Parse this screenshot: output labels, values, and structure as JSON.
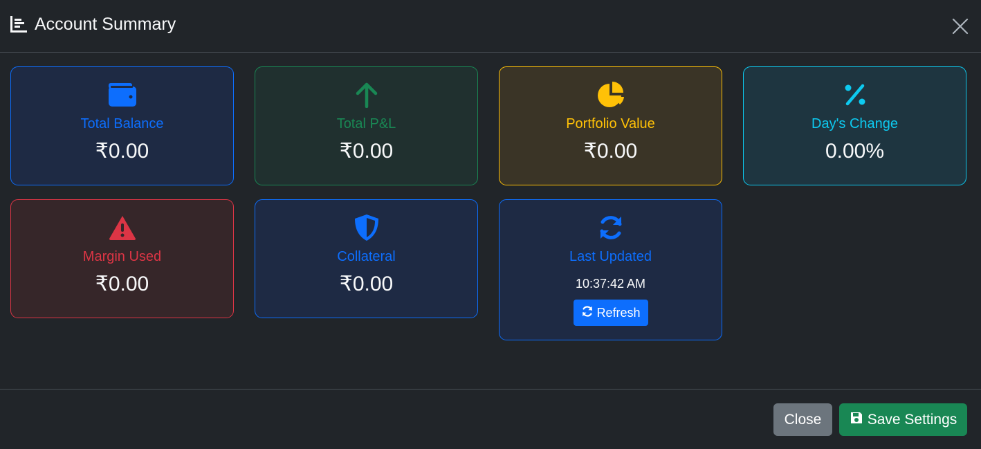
{
  "header": {
    "title": "Account Summary",
    "title_icon": "chart-bar-icon",
    "close_icon": "close-icon"
  },
  "cards": [
    {
      "label": "Total Balance",
      "value": "₹0.00",
      "icon": "wallet-icon",
      "color": "#0d6efd"
    },
    {
      "label": "Total P&L",
      "value": "₹0.00",
      "icon": "arrow-up-icon",
      "color": "#198754"
    },
    {
      "label": "Portfolio Value",
      "value": "₹0.00",
      "icon": "pie-chart-icon",
      "color": "#ffc107"
    },
    {
      "label": "Day's Change",
      "value": "0.00%",
      "icon": "percent-icon",
      "color": "#0dcaf0"
    },
    {
      "label": "Margin Used",
      "value": "₹0.00",
      "icon": "warning-icon",
      "color": "#dc3545"
    },
    {
      "label": "Collateral",
      "value": "₹0.00",
      "icon": "shield-icon",
      "color": "#0d6efd"
    },
    {
      "label": "Last Updated",
      "value": "10:37:42 AM",
      "icon": "sync-icon",
      "color": "#0d6efd",
      "action_label": "Refresh"
    }
  ],
  "footer": {
    "close_label": "Close",
    "save_label": "Save Settings",
    "save_icon": "save-icon"
  },
  "colors": {
    "background": "#212529",
    "blue": "#0d6efd",
    "green": "#198754",
    "yellow": "#ffc107",
    "cyan": "#0dcaf0",
    "red": "#dc3545",
    "gray": "#6c757d"
  }
}
